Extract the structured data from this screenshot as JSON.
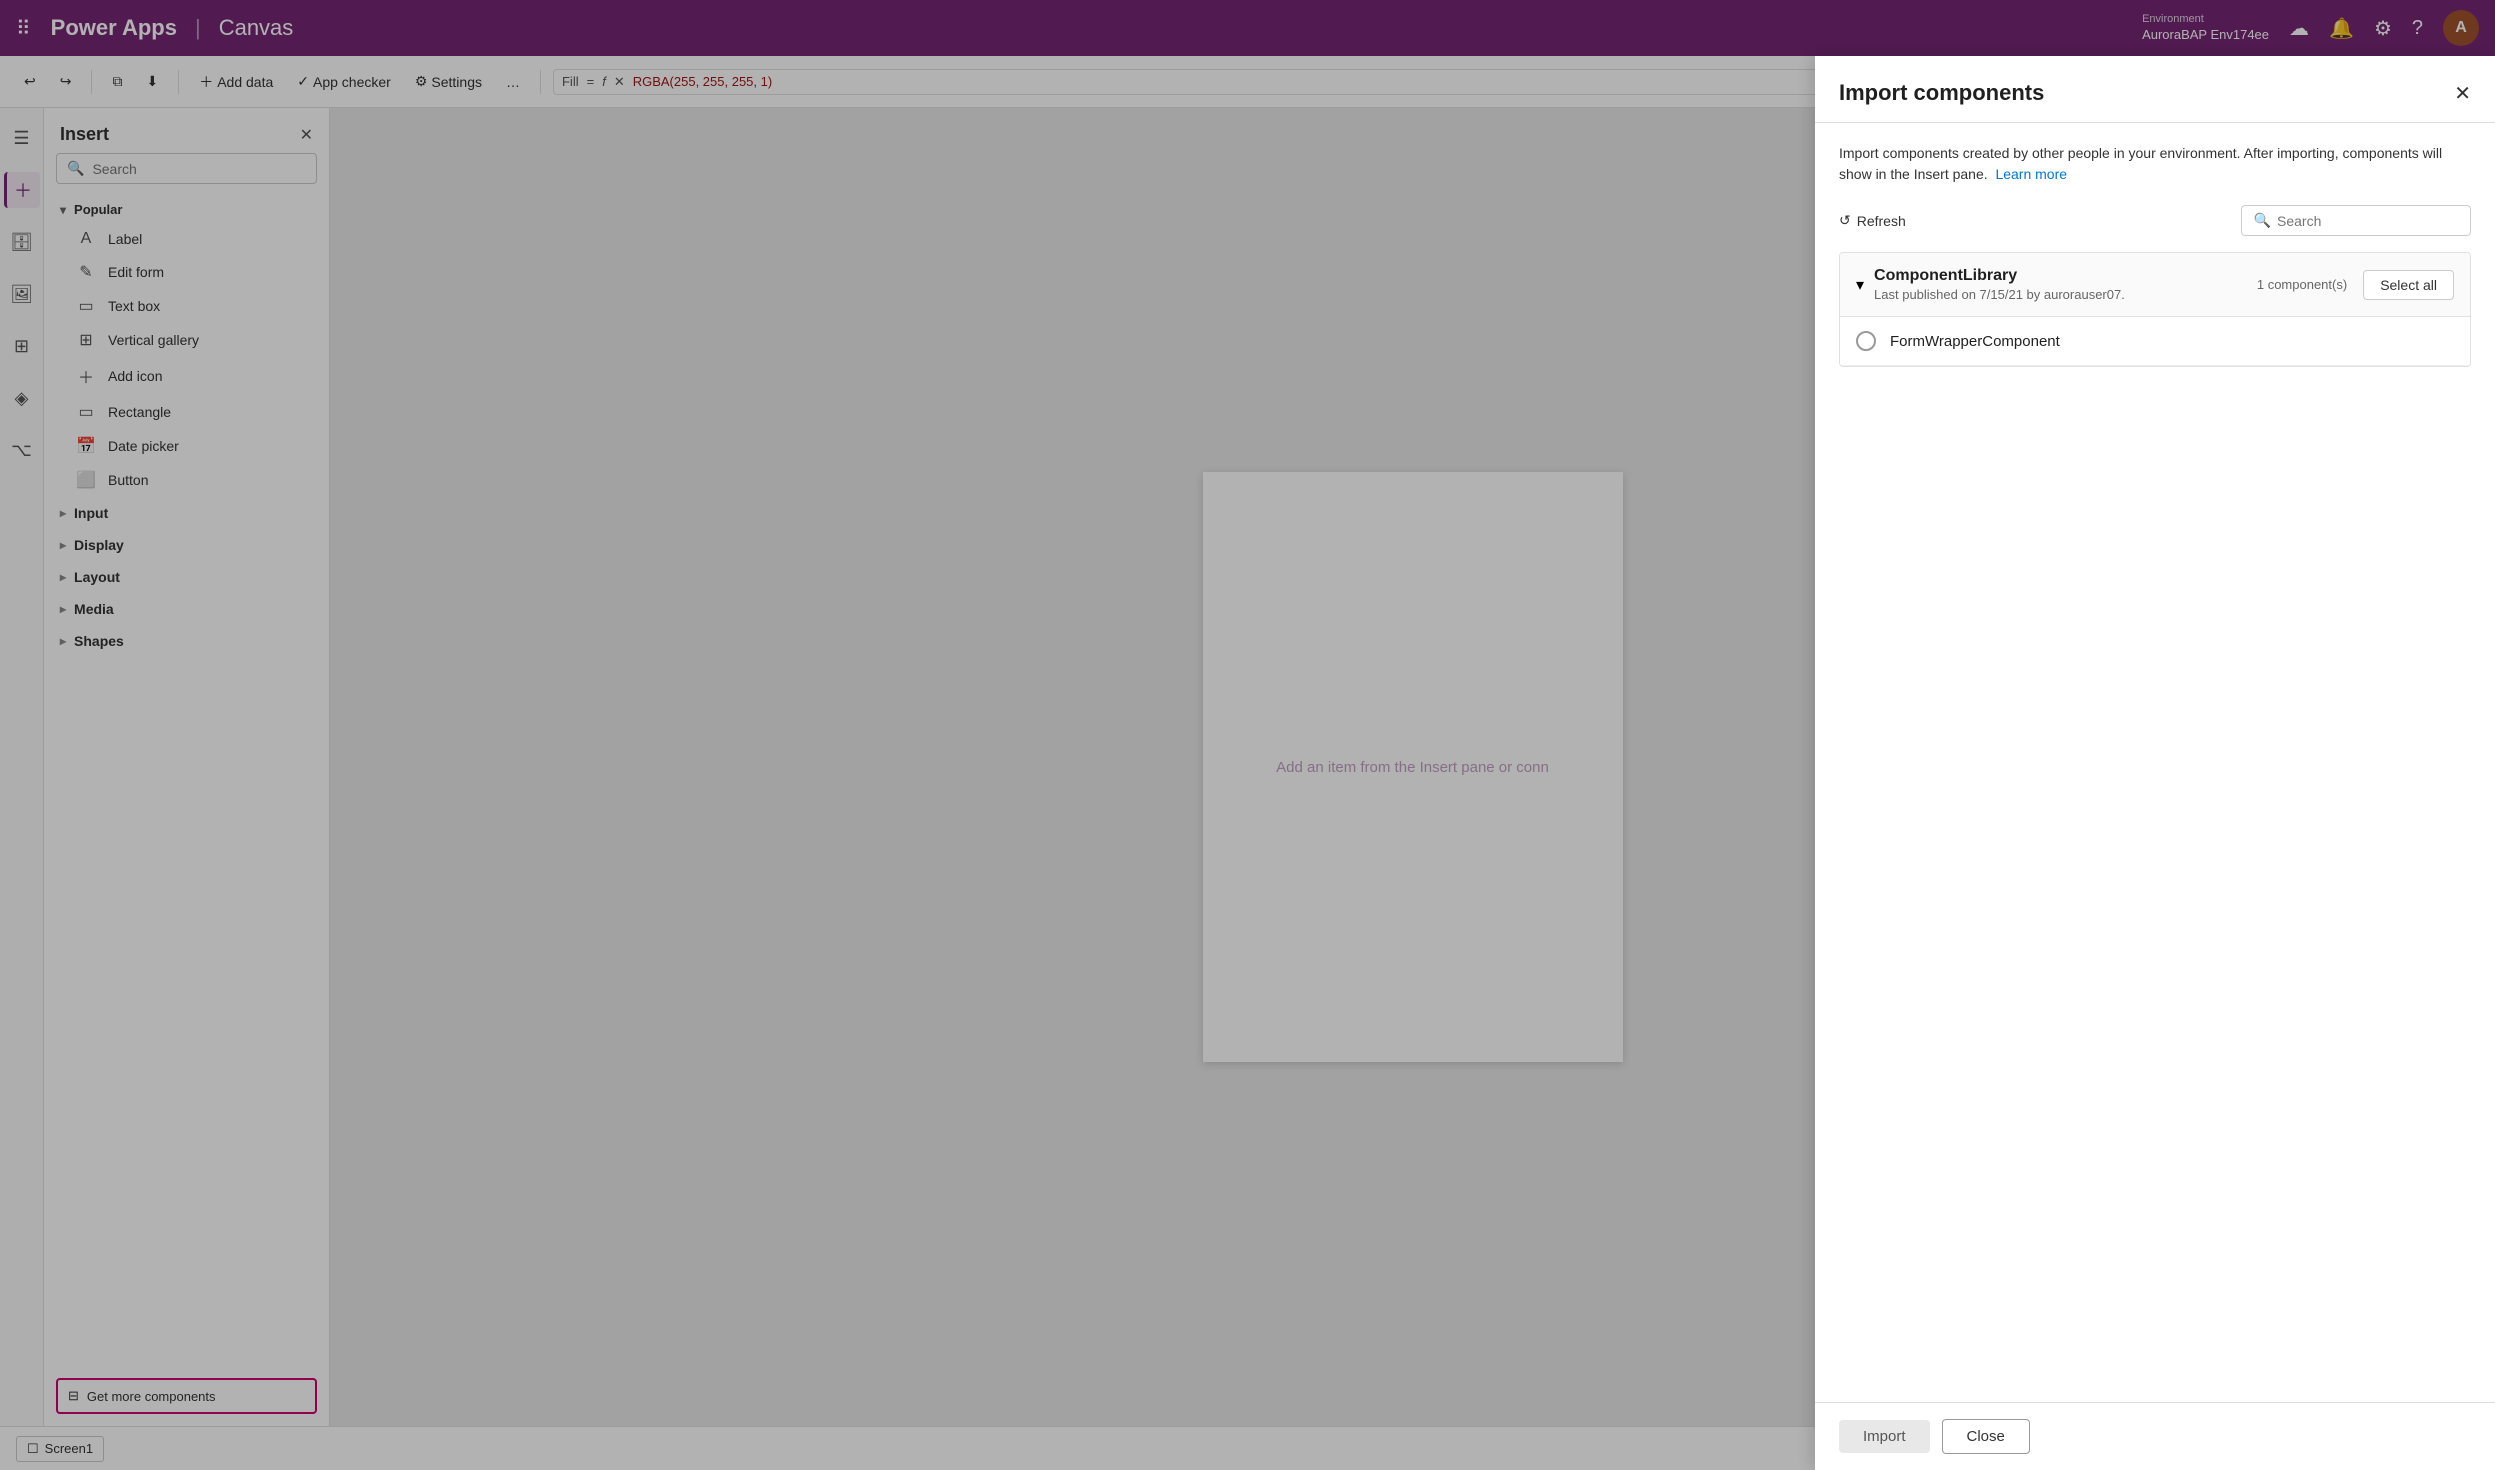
{
  "topbar": {
    "app_name": "Power Apps",
    "separator": "|",
    "subtitle": "Canvas",
    "env_label": "Environment",
    "env_name": "AuroraBAP Env174ee",
    "avatar_letter": "A"
  },
  "toolbar2": {
    "undo_label": "",
    "redo_label": "",
    "copy_label": "",
    "add_data_label": "Add data",
    "app_checker_label": "App checker",
    "settings_label": "Settings",
    "formula_property": "Fill",
    "formula_value": "RGBA(255, 255, 255, 1)"
  },
  "insert_panel": {
    "title": "Insert",
    "search_placeholder": "Search",
    "get_more_label": "Get more components",
    "sections": [
      {
        "label": "Popular",
        "expanded": true,
        "items": [
          {
            "label": "Label",
            "icon": "A"
          },
          {
            "label": "Edit form",
            "icon": "✎"
          },
          {
            "label": "Text box",
            "icon": "▭"
          },
          {
            "label": "Vertical gallery",
            "icon": "⊞"
          },
          {
            "label": "Add icon",
            "icon": "+"
          },
          {
            "label": "Rectangle",
            "icon": "▭"
          },
          {
            "label": "Date picker",
            "icon": "📅"
          },
          {
            "label": "Button",
            "icon": "⬜"
          }
        ]
      }
    ],
    "categories": [
      {
        "label": "Input"
      },
      {
        "label": "Display"
      },
      {
        "label": "Layout"
      },
      {
        "label": "Media"
      },
      {
        "label": "Shapes"
      }
    ]
  },
  "canvas": {
    "placeholder_text": "Add an item from the Insert pane or conn",
    "placeholder_link": "or conn"
  },
  "bottom_bar": {
    "screen_label": "Screen1"
  },
  "modal": {
    "title": "Import components",
    "description": "Import components created by other people in your environment. After importing, components will show in the Insert pane.",
    "learn_more": "Learn more",
    "refresh_label": "Refresh",
    "search_placeholder": "Search",
    "library": {
      "name": "ComponentLibrary",
      "meta": "Last published on 7/15/21 by aurorauser07.",
      "count": "1 component(s)",
      "select_all_label": "Select all",
      "items": [
        {
          "name": "FormWrapperComponent"
        }
      ]
    },
    "import_label": "Import",
    "close_label": "Close"
  }
}
